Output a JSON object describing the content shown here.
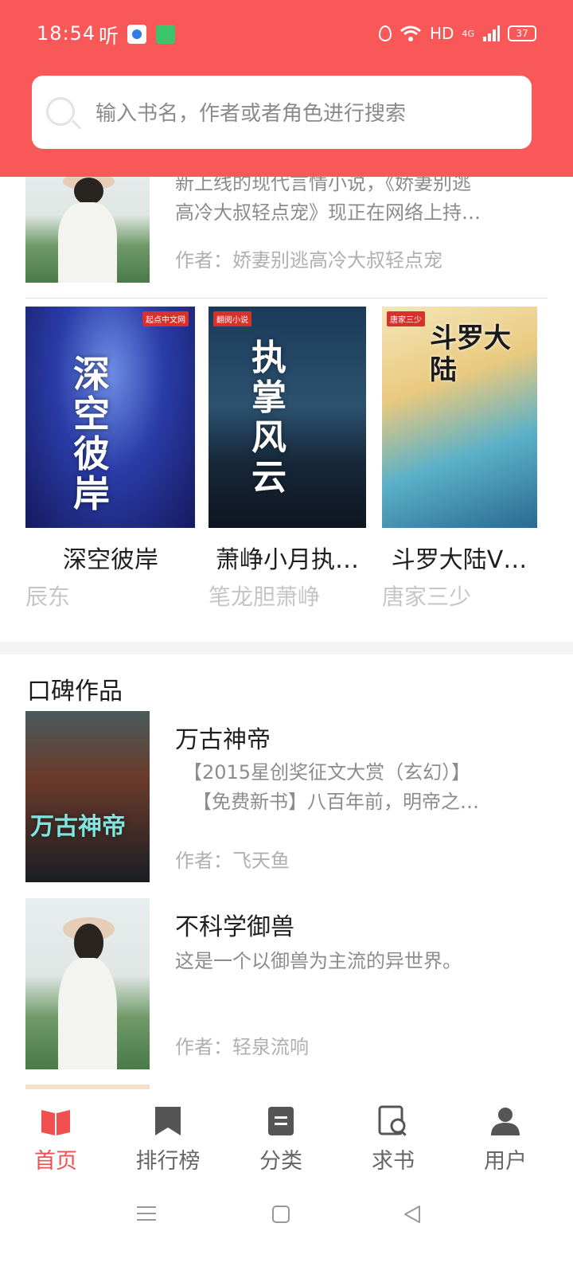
{
  "status_bar": {
    "time": "18:54",
    "ting_label": "听",
    "network": "HD",
    "signal": "4G",
    "battery": "37"
  },
  "search": {
    "placeholder": "输入书名，作者或者角色进行搜索"
  },
  "featured_partial": {
    "desc_line1": "新上线的现代言情小说，《娇妻别逃",
    "desc_line2": "高冷大叔轻点宠》现正在网络上持…",
    "author": "作者：娇妻别逃高冷大叔轻点宠"
  },
  "grid_books": [
    {
      "title": "深空彼岸",
      "author": "辰东",
      "cover_text": "深空彼岸",
      "cover_badge": "起点中文网"
    },
    {
      "title": "萧峥小月执…",
      "author": "笔龙胆萧峥",
      "cover_text": "执掌风云",
      "cover_badge": "翻阅小说"
    },
    {
      "title": "斗罗大陆V…",
      "author": "唐家三少",
      "cover_text": "斗罗大陆",
      "cover_badge": "唐家三少"
    }
  ],
  "section": {
    "title": "口碑作品"
  },
  "list_books": [
    {
      "title": "万古神帝",
      "desc_line1": "【2015星创奖征文大赏（玄幻）】",
      "desc_line2": "　【免费新书】八百年前，明帝之…",
      "author": "作者：飞天鱼",
      "cover_text": "万古神帝"
    },
    {
      "title": "不科学御兽",
      "desc_line1": "这是一个以御兽为主流的异世界。",
      "desc_line2": "",
      "author": "作者：轻泉流响"
    }
  ],
  "bottom_nav": [
    {
      "label": "首页",
      "icon": "book-open-icon",
      "active": true
    },
    {
      "label": "排行榜",
      "icon": "bookmark-icon",
      "active": false
    },
    {
      "label": "分类",
      "icon": "category-icon",
      "active": false
    },
    {
      "label": "求书",
      "icon": "book-search-icon",
      "active": false
    },
    {
      "label": "用户",
      "icon": "user-icon",
      "active": false
    }
  ],
  "colors": {
    "brand": "#f85858",
    "active_tab": "#f05050",
    "text_muted": "#8c8c8c"
  }
}
